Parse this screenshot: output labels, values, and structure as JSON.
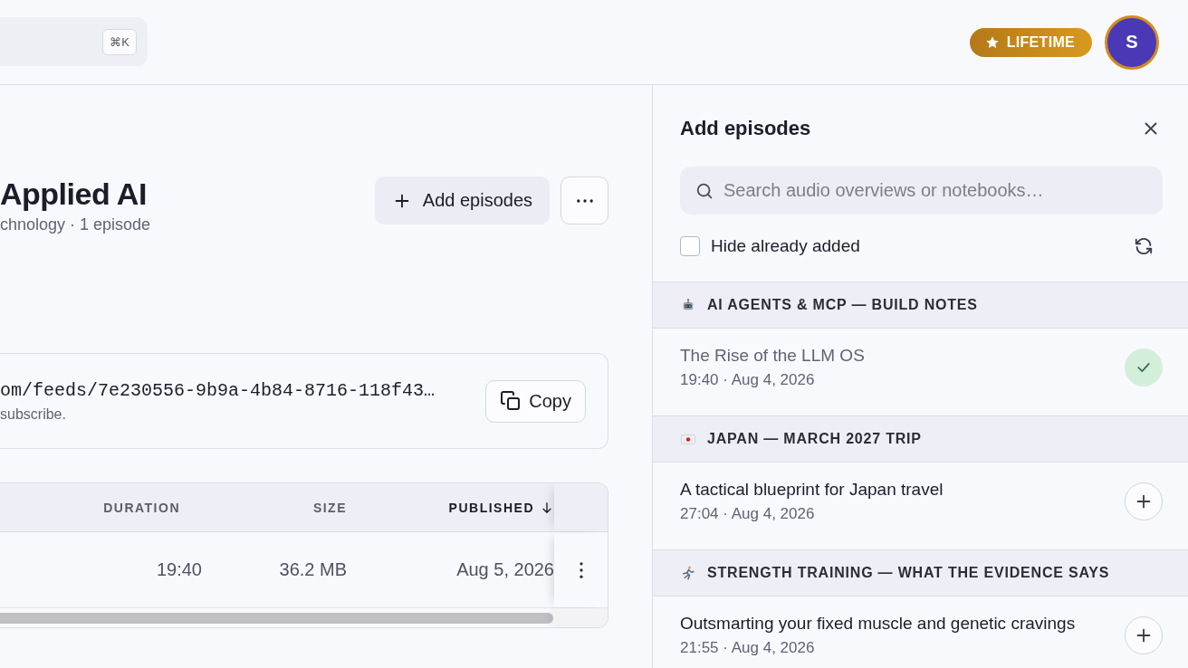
{
  "topbar": {
    "search": {
      "shortcut": "⌘K"
    },
    "plan_badge": {
      "label": "LIFETIME"
    },
    "avatar": {
      "initial": "S"
    }
  },
  "podcast": {
    "title": "Applied AI",
    "meta": "chnology · 1 episode",
    "add_button": {
      "label": "Add episodes"
    }
  },
  "feed": {
    "url": "om/feeds/7e230556-9b9a-4b84-8716-118f43…",
    "hint": "subscribe.",
    "copy_button": {
      "label": "Copy"
    }
  },
  "table": {
    "columns": [
      {
        "label": "DURATION",
        "sorted": false
      },
      {
        "label": "SIZE",
        "sorted": false
      },
      {
        "label": "PUBLISHED",
        "sorted": true
      }
    ],
    "rows": [
      {
        "duration": "19:40",
        "size": "36.2 MB",
        "published": "Aug 5, 2026"
      }
    ]
  },
  "panel": {
    "title": "Add episodes",
    "search": {
      "placeholder": "Search audio overviews or notebooks…"
    },
    "hide_added": {
      "label": "Hide already added",
      "checked": false
    },
    "groups": [
      {
        "kind": "robot",
        "title": "AI AGENTS & MCP — BUILD NOTES",
        "episodes": [
          {
            "title": "The Rise of the LLM OS",
            "meta": "19:40 · Aug 4, 2026",
            "added": true
          }
        ]
      },
      {
        "kind": "flag",
        "title": "JAPAN — MARCH 2027 TRIP",
        "episodes": [
          {
            "title": "A tactical blueprint for Japan travel",
            "meta": "27:04 · Aug 4, 2026",
            "added": false
          }
        ]
      },
      {
        "kind": "runner",
        "title": "STRENGTH TRAINING — WHAT THE EVIDENCE SAYS",
        "episodes": [
          {
            "title": "Outsmarting your fixed muscle and genetic cravings",
            "meta": "21:55 · Aug 4, 2026",
            "added": false
          }
        ]
      }
    ]
  }
}
